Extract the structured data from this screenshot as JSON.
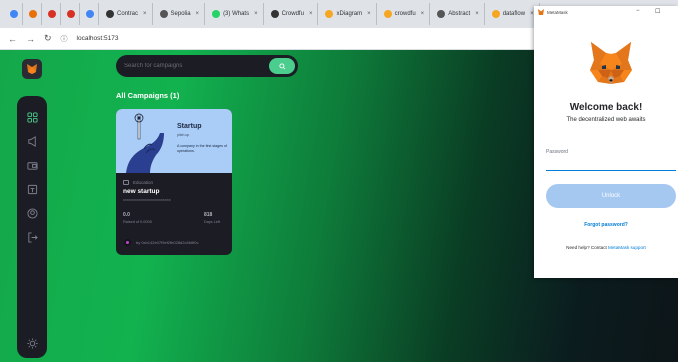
{
  "browser": {
    "tabs": [
      {
        "label": "",
        "color": "#4285f4"
      },
      {
        "label": "",
        "color": "#e8710a"
      },
      {
        "label": "",
        "color": "#d93025"
      },
      {
        "label": "",
        "color": "#d93025"
      },
      {
        "label": "",
        "color": "#4285f4"
      },
      {
        "label": "Contrac",
        "color": "#333333"
      },
      {
        "label": "Sepolia",
        "color": "#555555"
      },
      {
        "label": "(3) Whats",
        "color": "#25d366"
      },
      {
        "label": "Crowdfu",
        "color": "#333333"
      },
      {
        "label": "xDiagram",
        "color": "#f5a623"
      },
      {
        "label": "crowdfu",
        "color": "#f5a623"
      },
      {
        "label": "Abstract",
        "color": "#555555"
      },
      {
        "label": "dataflow",
        "color": "#f5a623"
      }
    ],
    "url": "localhost:5173"
  },
  "app": {
    "search_placeholder": "Search for campaigns",
    "section_title": "All Campaigns (1)"
  },
  "campaign": {
    "image_title": "Startup",
    "image_subtitle": "pitch up",
    "image_desc": "A company in the first stages of operations.",
    "category": "Education",
    "title": "new startup",
    "description": "xxxxxxxxxxxxxxxxxxxxxxxx",
    "raised_value": "0.0",
    "raised_label": "Raised of 0.0008",
    "days_value": "818",
    "days_label": "Days Left",
    "owner": "by 0xb142e07f9ef2fb028d2c5b6f0c"
  },
  "metamask": {
    "window_title": "MetaMask",
    "welcome": "Welcome back!",
    "tagline": "The decentralized web awaits",
    "password_label": "Password",
    "unlock": "Unlock",
    "forgot": "Forgot password?",
    "help_prefix": "Need help? Contact ",
    "help_link": "MetaMask support"
  }
}
